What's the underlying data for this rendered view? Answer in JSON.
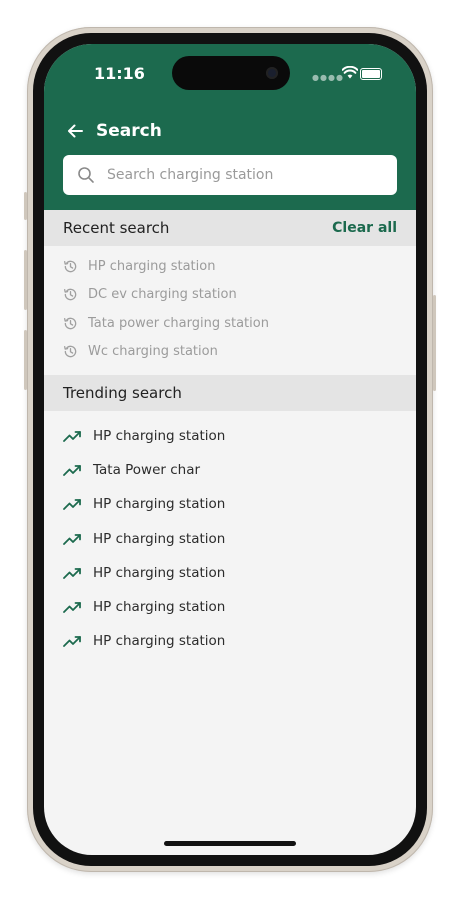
{
  "status_bar": {
    "time": "11:16"
  },
  "header": {
    "title": "Search"
  },
  "search": {
    "placeholder": "Search charging station"
  },
  "recent": {
    "title": "Recent search",
    "clear_label": "Clear all",
    "items": [
      {
        "label": "HP charging station"
      },
      {
        "label": "DC ev charging station"
      },
      {
        "label": "Tata power charging station"
      },
      {
        "label": "Wc charging station"
      }
    ]
  },
  "trending": {
    "title": "Trending search",
    "items": [
      {
        "label": "HP charging station"
      },
      {
        "label": "Tata Power char"
      },
      {
        "label": "HP charging station"
      },
      {
        "label": "HP charging station"
      },
      {
        "label": "HP charging station"
      },
      {
        "label": "HP charging station"
      },
      {
        "label": "HP charging station"
      }
    ]
  },
  "icons": {
    "back": "arrow-left-icon",
    "search": "search-icon",
    "history": "history-icon",
    "trending": "trending-up-icon"
  },
  "colors": {
    "brand": "#1c6a4e",
    "section_bg": "#e4e4e4",
    "screen_bg": "#f4f4f4"
  }
}
